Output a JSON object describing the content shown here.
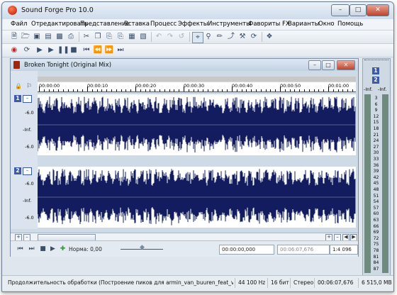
{
  "window": {
    "title": "Sound Forge Pro 10.0"
  },
  "menu": [
    "Файл",
    "Отредактировать",
    "Представление",
    "Вставка",
    "Процесс",
    "Эффекты",
    "Инструменты",
    "Фавориты FX",
    "Варианты",
    "Окно",
    "Помощь"
  ],
  "toolbar1": [
    {
      "icon": "new-file-icon"
    },
    {
      "icon": "open-folder-icon"
    },
    {
      "icon": "save-icon"
    },
    {
      "icon": "save-all-icon"
    },
    {
      "icon": "render-icon"
    },
    {
      "icon": "print-icon"
    },
    {
      "icon": "cut-icon"
    },
    {
      "icon": "copy-icon"
    },
    {
      "icon": "paste-icon"
    },
    {
      "icon": "paste-mix-icon"
    },
    {
      "icon": "trim-icon"
    },
    {
      "icon": "mute-icon"
    },
    {
      "icon": "undo-icon",
      "disabled": true
    },
    {
      "icon": "redo-icon",
      "disabled": true
    },
    {
      "icon": "repeat-icon",
      "disabled": true
    },
    {
      "icon": "edit-tool-icon"
    },
    {
      "icon": "magnify-tool-icon"
    },
    {
      "icon": "pencil-tool-icon"
    },
    {
      "icon": "envelope-tool-icon"
    },
    {
      "icon": "event-tool-icon"
    },
    {
      "icon": "loop-tool-icon"
    },
    {
      "icon": "snap-icon"
    }
  ],
  "toolbar2": [
    {
      "icon": "record-icon"
    },
    {
      "icon": "loop-playback-icon"
    },
    {
      "icon": "play-all-icon"
    },
    {
      "icon": "play-icon"
    },
    {
      "icon": "pause-icon"
    },
    {
      "icon": "stop-icon"
    },
    {
      "icon": "go-to-start-icon"
    },
    {
      "icon": "rewind-icon"
    },
    {
      "icon": "fast-forward-icon"
    },
    {
      "icon": "go-to-end-icon"
    }
  ],
  "data_window": {
    "title": "Broken Tonight (Original Mix)",
    "ruler": [
      "00:00:00",
      "00:00:10",
      "00:00:20",
      "00:00:30",
      "00:00:40",
      "00:00:50",
      "00:01:00"
    ],
    "channels": [
      {
        "number": "1",
        "db_labels": [
          "-6.0",
          "-Inf.",
          "-6.0"
        ]
      },
      {
        "number": "2",
        "db_labels": [
          "-6.0",
          "-Inf.",
          "-6.0"
        ]
      }
    ],
    "norm_label": "Норма: 0,00",
    "selection_start": "00:00:00,000",
    "selection_end": "00:06:07,676",
    "zoom_ratio": "1:4 096"
  },
  "meter": {
    "header": "-Inf.",
    "channels": [
      "1",
      "2"
    ],
    "scale": [
      "3",
      "6",
      "9",
      "12",
      "15",
      "18",
      "21",
      "24",
      "27",
      "30",
      "33",
      "36",
      "39",
      "42",
      "45",
      "48",
      "51",
      "54",
      "57",
      "60",
      "63",
      "66",
      "69",
      "72",
      "75",
      "78",
      "81",
      "84",
      "87"
    ]
  },
  "status": {
    "message": "Продолжительность обработки (Построение пиков для armin_van_buuren_feat_van_velzen_supe",
    "sample_rate": "44 100 Hz",
    "bit_depth": "16 бит",
    "channels": "Стерео",
    "length": "00:06:07,676",
    "free_space": "6 515,0 MB"
  },
  "colors": {
    "waveform": "#121c5e",
    "accent": "#3d5aa8",
    "title_accent": "#b81a00"
  }
}
